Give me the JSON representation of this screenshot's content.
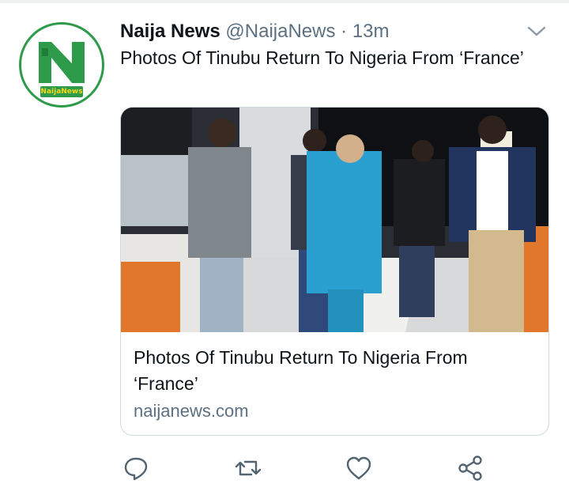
{
  "tweet": {
    "display_name": "Naija News",
    "handle": "@NaijaNews",
    "separator": "·",
    "time": "13m",
    "text": "Photos Of Tinubu Return To Nigeria From ‘France’",
    "avatar_brand": "NaijaNews"
  },
  "card": {
    "title": "Photos Of Tinubu Return To Nigeria From ‘France’",
    "domain": "naijanews.com"
  },
  "icons": {
    "menu": "chevron-down-icon",
    "actions": [
      "reply-icon",
      "retweet-icon",
      "like-icon",
      "share-icon"
    ]
  },
  "colors": {
    "text": "#0f1419",
    "secondary": "#5b7083",
    "brand_green": "#2e9b4a",
    "border": "#cfd9de"
  }
}
